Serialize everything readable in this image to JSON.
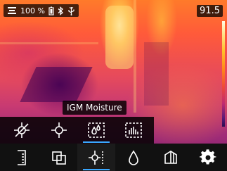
{
  "status": {
    "battery_percent": "100 %",
    "max_temp": "91.5"
  },
  "tooltip": {
    "label": "IGM Moisture"
  },
  "submenu": {
    "items": [
      {
        "icon": "crosshair-off-icon"
      },
      {
        "icon": "crosshair-icon"
      },
      {
        "icon": "moisture-frame-icon",
        "selected": true
      },
      {
        "icon": "histogram-frame-icon"
      }
    ]
  },
  "toolbar": {
    "items": [
      {
        "icon": "gallery-icon"
      },
      {
        "icon": "layers-icon"
      },
      {
        "icon": "spot-measure-icon",
        "selected": true
      },
      {
        "icon": "water-drop-icon"
      },
      {
        "icon": "palette-icon"
      },
      {
        "icon": "settings-gear-icon"
      }
    ]
  },
  "colors": {
    "accent": "#39a7ff",
    "bar_bg": "#000000"
  }
}
